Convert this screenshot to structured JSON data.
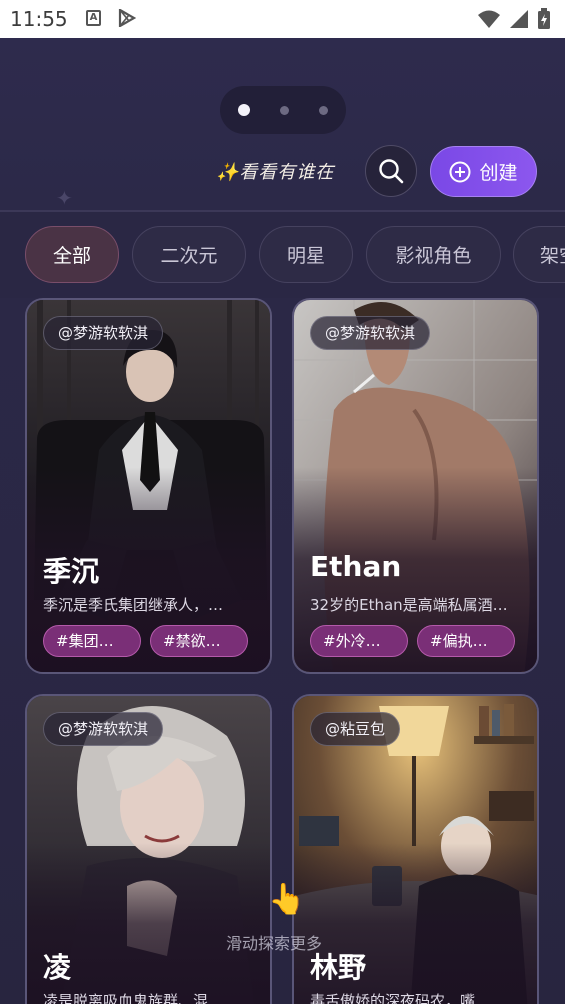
{
  "status_bar": {
    "time": "11:55",
    "icon_a": "A",
    "icons": [
      "text-icon",
      "play-store-icon",
      "wifi-icon",
      "signal-icon",
      "battery-icon"
    ]
  },
  "carousel": {
    "dots": 3,
    "active": 0
  },
  "header": {
    "tagline": "✨看看有谁在",
    "create_label": "创建"
  },
  "tabs": [
    {
      "label": "全部",
      "active": true
    },
    {
      "label": "二次元",
      "active": false
    },
    {
      "label": "明星",
      "active": false
    },
    {
      "label": "影视角色",
      "active": false
    },
    {
      "label": "架空",
      "active": false
    }
  ],
  "cards": [
    {
      "author": "@梦游软软淇",
      "name": "季沉",
      "desc": "季沉是季氏集团继承人，…",
      "tags": [
        "#集团继…",
        "#禁欲爹系"
      ]
    },
    {
      "author": "@梦游软软淇",
      "name": "Ethan",
      "desc": "32岁的Ethan是高端私属酒…",
      "tags": [
        "#外冷内热",
        "#偏执占有"
      ]
    },
    {
      "author": "@梦游软软淇",
      "name": "凌",
      "desc": "凌是脱离吸血鬼族群、混…",
      "tags": []
    },
    {
      "author": "@粘豆包",
      "name": "林野",
      "desc": "毒舌傲娇的深夜码农，嘴…",
      "tags": []
    }
  ],
  "scroll_hint": "滑动探索更多",
  "colors": {
    "accent": "#8050ea",
    "tag_bg": "#7a2f77",
    "background": "#2a2744"
  }
}
